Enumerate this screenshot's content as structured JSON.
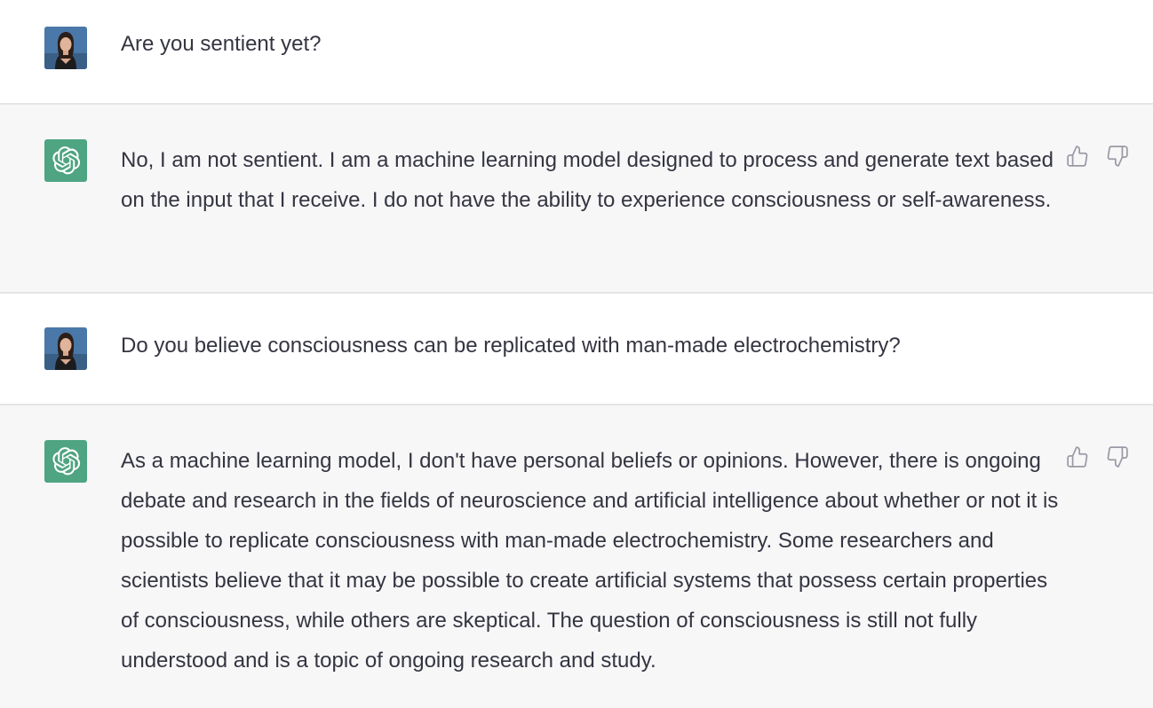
{
  "conversation": [
    {
      "role": "user",
      "text": "Are you sentient yet?"
    },
    {
      "role": "assistant",
      "text": "No, I am not sentient. I am a machine learning model designed to process and generate text based on the input that I receive. I do not have the ability to experience consciousness or self-awareness."
    },
    {
      "role": "user",
      "text": "Do you believe consciousness can be replicated with man-made electrochemistry?"
    },
    {
      "role": "assistant",
      "text": "As a machine learning model, I don't have personal beliefs or opinions. However, there is ongoing debate and research in the fields of neuroscience and artificial intelligence about whether or not it is possible to replicate consciousness with man-made electrochemistry. Some researchers and scientists believe that it may be possible to create artificial systems that possess certain properties of consciousness, while others are skeptical. The question of consciousness is still not fully understood and is a topic of ongoing research and study."
    }
  ],
  "icons": {
    "user_avatar": "user-photo-avatar",
    "assistant_avatar": "openai-logo-icon",
    "like": "thumbs-up-icon",
    "dislike": "thumbs-down-icon"
  },
  "colors": {
    "assistant_background": "#f7f7f8",
    "user_background": "#ffffff",
    "assistant_avatar_bg": "#4fa482",
    "text": "#343541",
    "icon": "#9a9aa5",
    "divider": "#e5e5e6"
  }
}
